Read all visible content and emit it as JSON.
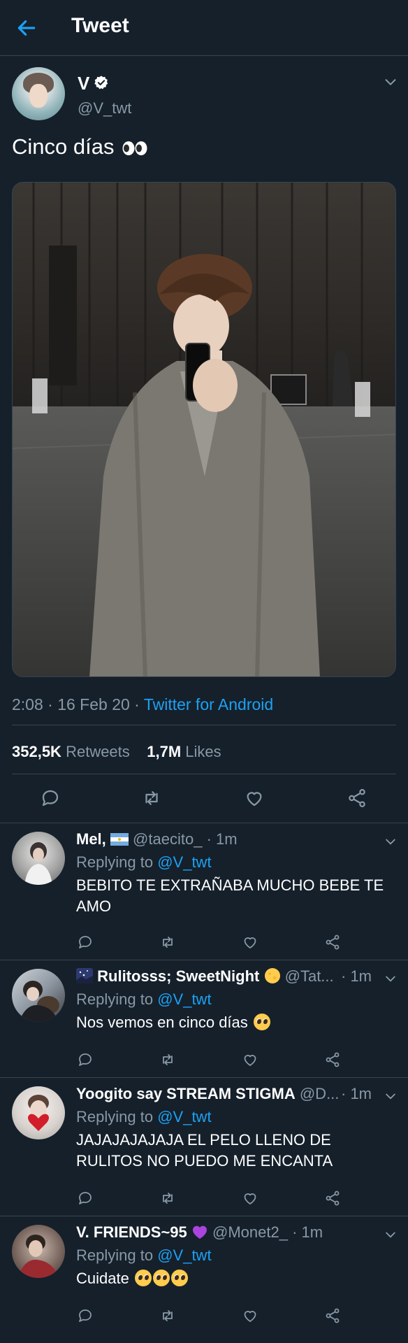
{
  "header": {
    "title": "Tweet"
  },
  "tweet": {
    "name": "V",
    "handle": "@V_twt",
    "text": "Cinco días",
    "timestamp": "2:08 · 16 Feb 20 · ",
    "source": "Twitter for Android",
    "retweets_count": "352,5K",
    "retweets_label": "Retweets",
    "likes_count": "1,7M",
    "likes_label": "Likes"
  },
  "replies": [
    {
      "name": "Mel,",
      "handle": "@taecito_",
      "time": "· 1m",
      "replying_label": "Replying to",
      "replying_to": "@V_twt",
      "text": "BEBITO TE EXTRAÑABA MUCHO BEBE TE AMO"
    },
    {
      "name": "Rulitosss; SweetNight",
      "handle": "@Tat...",
      "time": "· 1m",
      "replying_label": "Replying to",
      "replying_to": "@V_twt",
      "text": "Nos vemos en cinco días"
    },
    {
      "name": "Yoogito say STREAM STIGMA",
      "handle": "@D...",
      "time": "· 1m",
      "replying_label": "Replying to",
      "replying_to": "@V_twt",
      "text": "JAJAJAJAJAJA EL PELO LLENO DE RULITOS NO PUEDO ME ENCANTA"
    },
    {
      "name": "V. FRIENDS~95",
      "handle": "@Monet2_",
      "time": "· 1m",
      "replying_label": "Replying to",
      "replying_to": "@V_twt",
      "text": "Cuidate"
    }
  ],
  "colors": {
    "background": "#15202b",
    "accent": "#1da1f2",
    "secondary_text": "#8899a6",
    "divider": "#38444d"
  },
  "icons": [
    "back-arrow-icon",
    "verified-icon",
    "chevron-down-icon",
    "reply-icon",
    "retweet-icon",
    "like-icon",
    "share-icon"
  ]
}
